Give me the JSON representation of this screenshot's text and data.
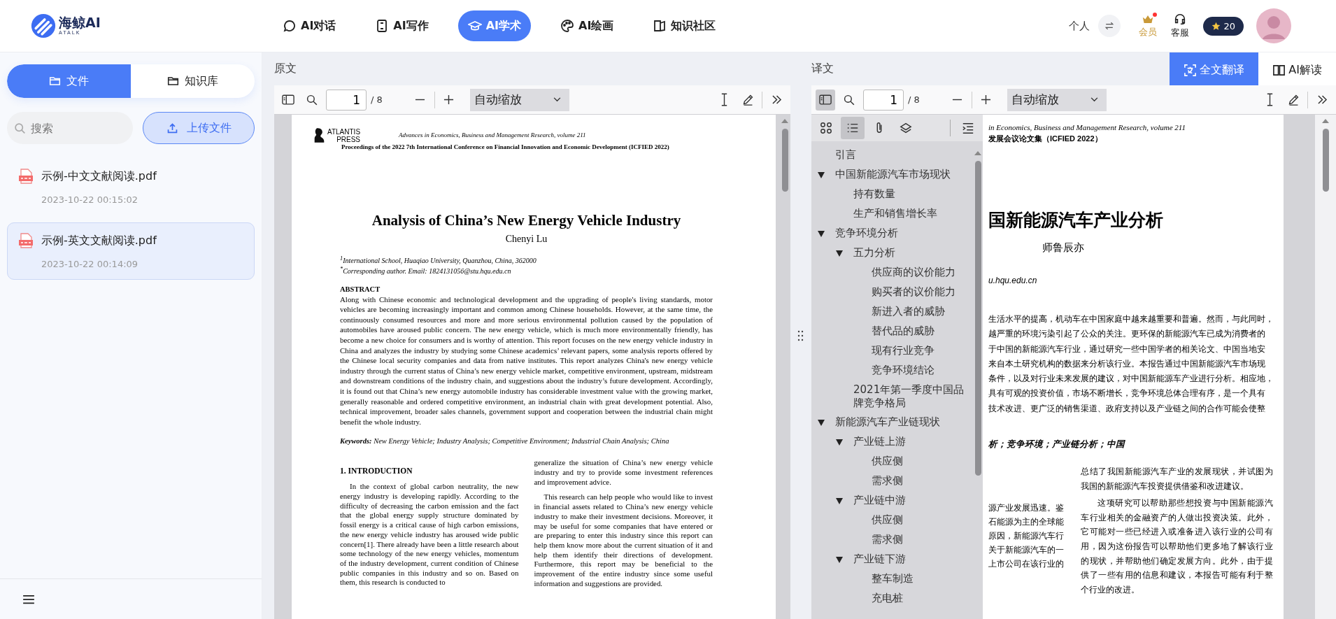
{
  "header": {
    "logo": {
      "name": "海鲸AI",
      "tagline": "ATALK"
    },
    "nav": [
      {
        "kind": "chat",
        "label": "AI对话",
        "selected": false
      },
      {
        "kind": "write",
        "label": "AI写作",
        "selected": false
      },
      {
        "kind": "academic",
        "label": "AI学术",
        "selected": true
      },
      {
        "kind": "paint",
        "label": "AI绘画",
        "selected": false
      },
      {
        "kind": "community",
        "label": "知识社区",
        "selected": false
      }
    ],
    "user": {
      "personal": "个人",
      "member": "会员",
      "member_notice": true,
      "service": "客服",
      "points": "20"
    }
  },
  "sidebar": {
    "tabs": [
      {
        "label": "文件",
        "selected": true
      },
      {
        "label": "知识库",
        "selected": false
      }
    ],
    "search": {
      "placeholder": "搜索"
    },
    "upload": "上传文件",
    "files": [
      {
        "name": "示例-中文文献阅读.pdf",
        "date": "2023-10-22 00:15:02",
        "selected": false
      },
      {
        "name": "示例-英文文献阅读.pdf",
        "date": "2023-10-22 00:14:09",
        "selected": true
      }
    ]
  },
  "original": {
    "label": "原文",
    "toolbar": {
      "sidebar_open": false,
      "page": "1",
      "page_count": "/ 8",
      "zoom": "自动缩放"
    },
    "page": {
      "publisher": [
        "ATLANTIS",
        "PRESS"
      ],
      "series": "Advances in Economics, Business and Management Research, volume 211",
      "proceedings": "Proceedings of the 2022 7th International Conference on Financial Innovation and Economic Development (ICFIED 2022)",
      "title": "Analysis of China’s New Energy Vehicle Industry",
      "author": "Chenyi Lu",
      "affiliations": [
        "$^{1}$International School, Huaqiao University, Quanzhou, China, 362000",
        "$^{*}$Corresponding author. Email: 1824131056@stu.hqu.edu.cn"
      ],
      "abstract_heading": "ABSTRACT",
      "abstract": "Along with Chinese economic and technological development and the upgrading of people's living standards, motor vehicles are becoming increasingly important and common among Chinese households. However, at the same time, the continuously consumed resources and more and more serious environmental pollution caused by the population of automobiles have aroused public concern. The new energy vehicle, which is much more environmentally friendly, has become a new choice for consumers and is worthy of attention. This report focuses on the new energy vehicle industry in China and analyzes the industry by studying some Chinese academics’ relevant papers, some analysis reports offered by the Chinese local security companies and data from native institutes. This report analyzes China's new energy vehicle industry through the current status of China’s new energy vehicle market, competitive environment, upstream, midstream and downstream conditions of the industry chain, and suggestions about the industry’s future development. Accordingly, it is found out that China’s new energy automobile industry has considerable investment value with the growing market, generally reasonable and ordered competitive environment, an industrial chain with great development potential. Also, technical improvement, broader sales channels, government support and cooperation between the industrial chain might benefit the whole industry.",
      "keywords": "**Keywords:** New Energy Vehicle; Industry Analysis; Competitive Environment; Industrial Chain Analysis; China",
      "section_heading": "1. INTRODUCTION",
      "left_column": [
        "In the context of global carbon neutrality, the new energy industry is developing rapidly. According to the difficulty of decreasing the carbon emission and the fact that the global energy supply structure dominated by fossil energy is a critical cause of high carbon emissions, the new energy vehicle industry has aroused wide public concern[1]. There already have been a little research about some technology of the new energy vehicles, momentum of the industry development, current condition of Chinese public companies in this industry and so on. Based on them, this research is conducted to"
      ],
      "right_column": [
        "generalize the situation of China’s new energy vehicle industry and try to provide some investment references and improvement advice.",
        "This research can help people who would like to invest in financial assets related to China’s new energy vehicle industry to make their investment decisions. Moreover, it may be useful for some companies that have entered or are preparing to enter this industry since this report can help them know more about the current situation of it and help them identify their directions of development. Furthermore, this report may be beneficial to the improvement of the entire industry since some useful information and suggestions are provided."
      ]
    }
  },
  "translation": {
    "label": "译文",
    "actions": [
      {
        "kind": "translate",
        "label": "全文翻译",
        "selected": true
      },
      {
        "kind": "interpret",
        "label": "AI解读",
        "selected": false
      }
    ],
    "toolbar": {
      "sidebar_open": true,
      "page": "1",
      "page_count": "/ 8",
      "zoom": "自动缩放"
    },
    "outline": {
      "tabs": [
        {
          "kind": "thumbnails",
          "selected": false
        },
        {
          "kind": "outline",
          "selected": true
        },
        {
          "kind": "attachments",
          "selected": false
        },
        {
          "kind": "layers",
          "selected": false
        }
      ],
      "items": [
        {
          "label": "引言"
        },
        {
          "label": "中国新能源汽车市场现状",
          "expanded": true,
          "children": [
            {
              "label": "持有数量"
            },
            {
              "label": "生产和销售增长率"
            }
          ]
        },
        {
          "label": "竞争环境分析",
          "expanded": true,
          "children": [
            {
              "label": "五力分析",
              "expanded": true,
              "children": [
                {
                  "label": "供应商的议价能力"
                },
                {
                  "label": "购买者的议价能力"
                },
                {
                  "label": "新进入者的威胁"
                },
                {
                  "label": "替代品的威胁"
                },
                {
                  "label": "现有行业竞争"
                },
                {
                  "label": "竞争环境结论"
                }
              ]
            },
            {
              "label": "2021年第一季度中国品牌竞争格局"
            }
          ]
        },
        {
          "label": "新能源汽车产业链现状",
          "expanded": true,
          "children": [
            {
              "label": "产业链上游",
              "expanded": true,
              "children": [
                {
                  "label": "供应侧"
                },
                {
                  "label": "需求侧"
                }
              ]
            },
            {
              "label": "产业链中游",
              "expanded": true,
              "children": [
                {
                  "label": "供应侧"
                },
                {
                  "label": "需求侧"
                }
              ]
            },
            {
              "label": "产业链下游",
              "expanded": true,
              "children": [
                {
                  "label": "整车制造"
                },
                {
                  "label": "充电桩"
                }
              ]
            }
          ]
        }
      ]
    },
    "page": {
      "series": "in Economics, Business and Management Research, volume 211",
      "proceedings": "发展会议论文集（ICFIED 2022）",
      "title": "国新能源汽车产业分析",
      "author": "师鲁辰亦",
      "email": "u.hqu.edu.cn",
      "abstract_lines": [
        "生活水平的提高，机动车在中国家庭中越来越重要和普遍。然而，与此同时，",
        "越严重的环境污染引起了公众的关注。更环保的新能源汽车已成为消费者的",
        "于中国的新能源汽车行业，通过研究一些中国学者的相关论文、中国当地安",
        "来自本土研究机构的数据来分析该行业。本报告通过中国新能源汽车市场现",
        "条件，以及对行业未来发展的建议，对中国新能源车产业进行分析。相应地，",
        "具有可观的投资价值，市场不断增长，竞争环境总体合理有序，是一个具有",
        "技术改进、更广泛的销售渠道、政府支持以及产业链之间的合作可能会使整"
      ],
      "keywords": "析；竞争环境；产业链分析；中国",
      "left_column_lines": [
        "源产业发展迅速。鉴",
        "石能源为主的全球能",
        "原因，新能源汽车行",
        "关于新能源汽车的一",
        "上市公司在该行业的"
      ],
      "right_column": [
        "总结了我国新能源汽车产业的发展现状，并试图为我国的新能源汽车投资提供借鉴和改进建议。",
        "这项研究可以帮助那些想投资与中国新能源汽车行业相关的金融资产的人做出投资决策。此外，它可能对一些已经进入或准备进入该行业的公司有用，因为这份报告可以帮助他们更多地了解该行业的现状，并帮助他们确定发展方向。此外，由于提供了一些有用的信息和建议，本报告可能有利于整个行业的改进。"
      ]
    }
  }
}
